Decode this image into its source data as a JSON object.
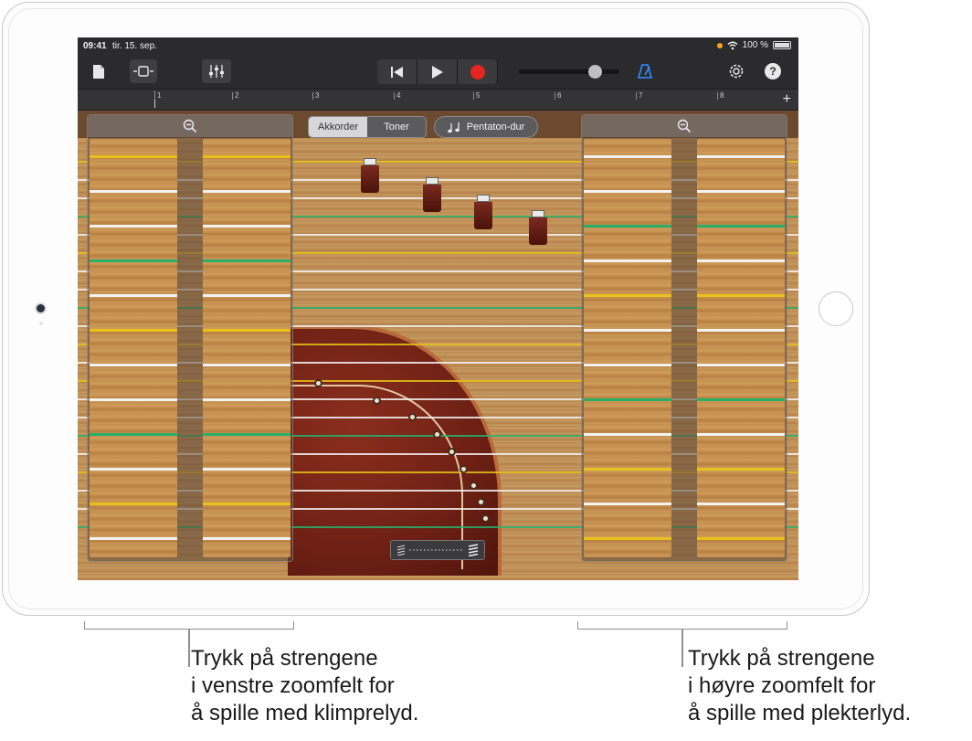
{
  "statusbar": {
    "time": "09:41",
    "date": "tir. 15. sep.",
    "battery": "100 %"
  },
  "toolbar": {
    "icons": [
      "document-icon",
      "track-view-icon",
      "mixer-icon",
      "rewind-icon",
      "play-icon",
      "record-icon",
      "metronome-icon",
      "settings-icon",
      "help-icon"
    ],
    "help_label": "?",
    "volume_level": 0.8
  },
  "ruler": {
    "bars": [
      "1",
      "2",
      "3",
      "4",
      "5",
      "6",
      "7",
      "8"
    ],
    "add_label": "+"
  },
  "instrument": {
    "modes": [
      "Akkorder",
      "Toner"
    ],
    "active_mode": "Akkorder",
    "scale_label": "Pentaton-dur",
    "string_colors": [
      "#e6c21a",
      "#f2f2f2",
      "#f2f2f2",
      "#28b06a",
      "#f2f2f2",
      "#e6c21a",
      "#f2f2f2",
      "#f2f2f2",
      "#28b06a",
      "#f2f2f2",
      "#e6c21a",
      "#f2f2f2"
    ],
    "accent_colors": {
      "yellow": "#e6c21a",
      "green": "#28b06a",
      "white": "#f2f2f2"
    }
  },
  "callouts": {
    "left": "Trykk på strengene\ni venstre zoomfelt for\nå spille med klimprelyd.",
    "right": "Trykk på strengene\ni høyre zoomfelt for\nå spille med plekterlyd."
  }
}
